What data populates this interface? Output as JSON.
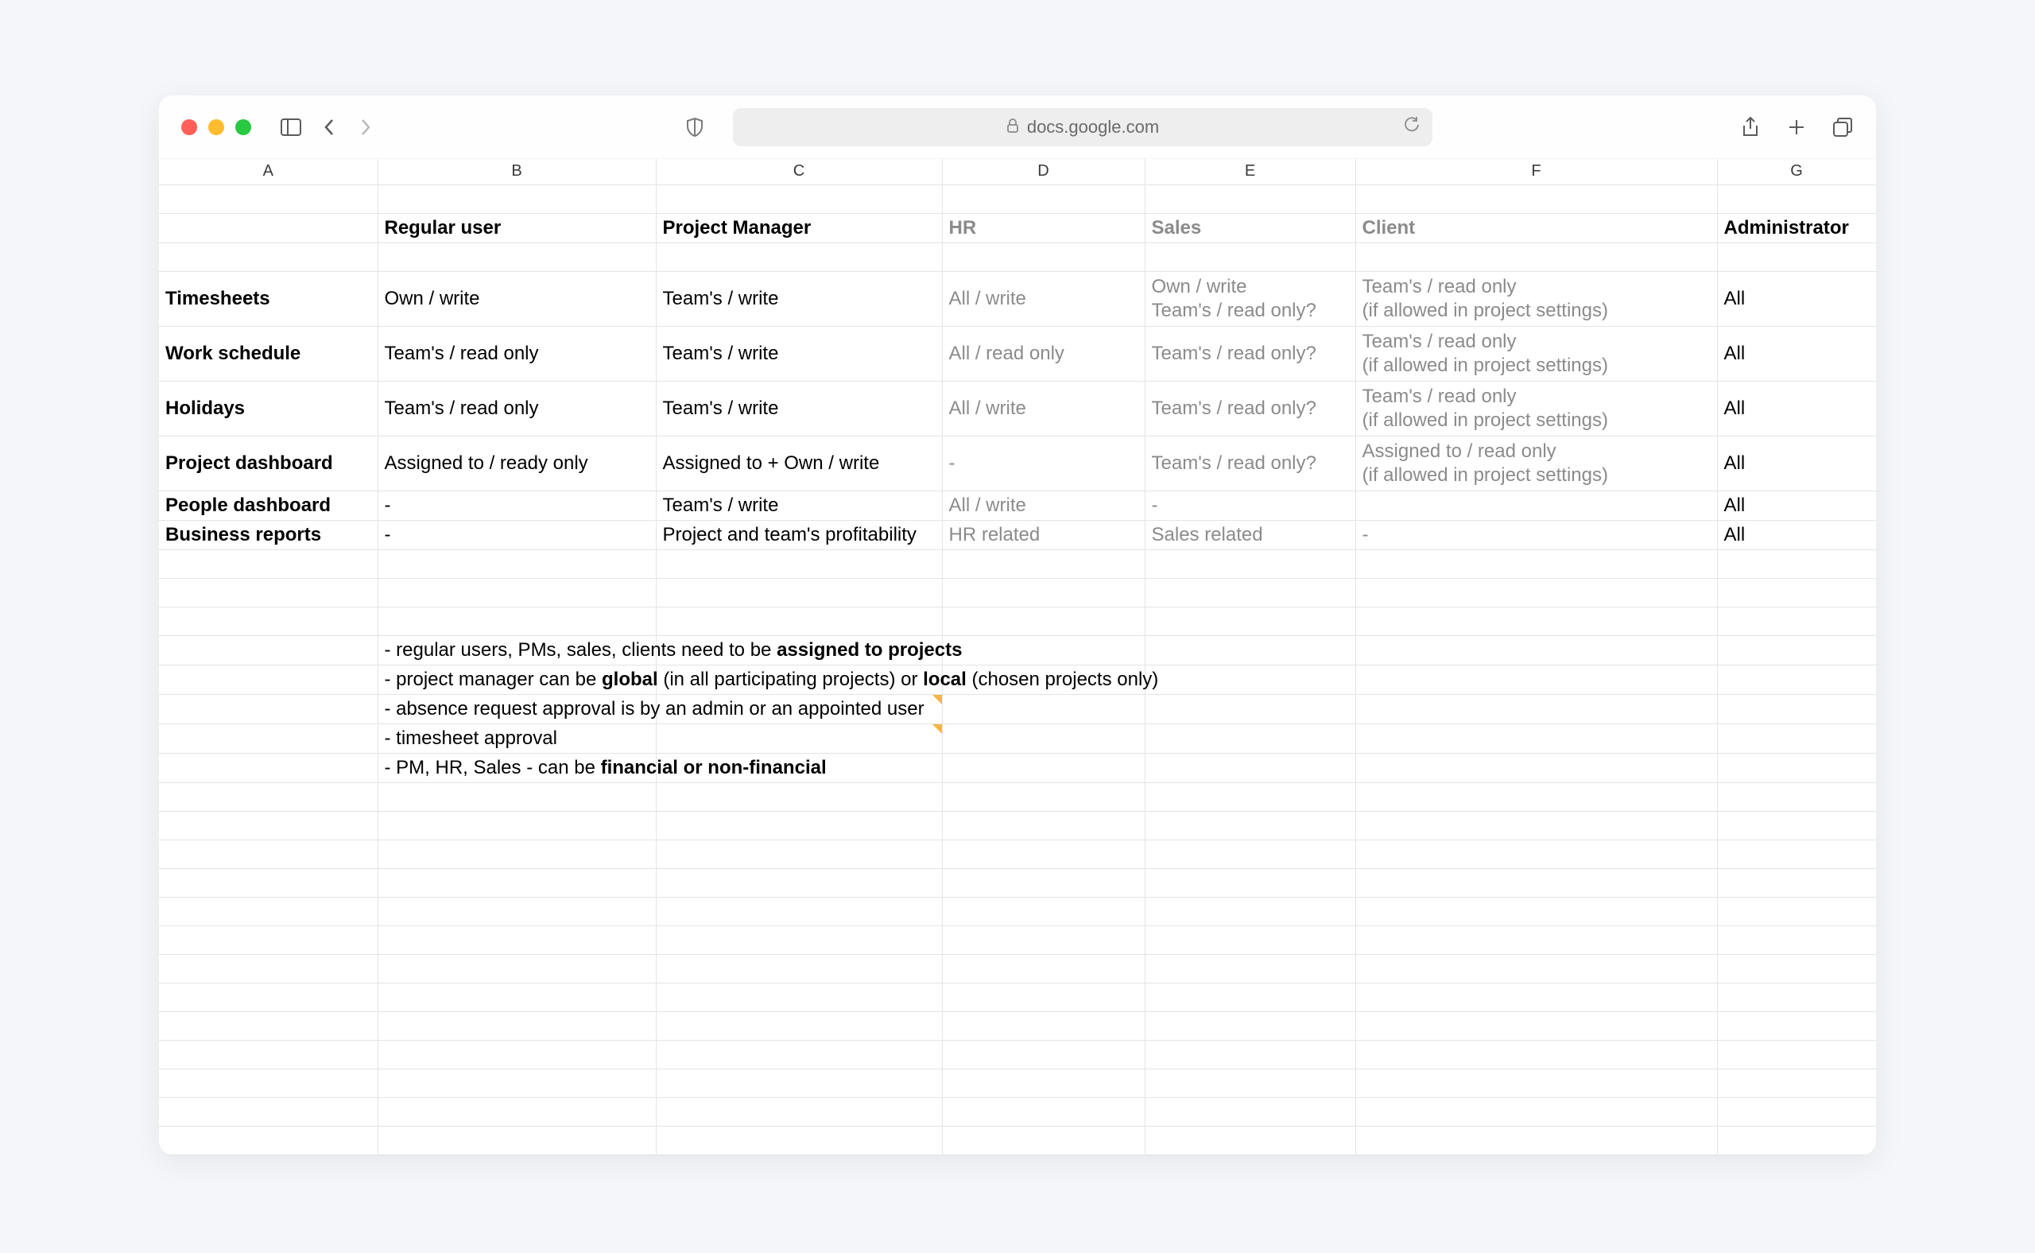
{
  "toolbar": {
    "url": "docs.google.com"
  },
  "columns": [
    "A",
    "B",
    "C",
    "D",
    "E",
    "F",
    "G"
  ],
  "headers": {
    "B": "Regular user",
    "C": "Project Manager",
    "D": "HR",
    "E": "Sales",
    "F": "Client",
    "G": "Administrator"
  },
  "rows": [
    {
      "label": "Timesheets",
      "B": "Own / write",
      "C": "Team's / write",
      "D": "All / write",
      "E": "Own / write\nTeam's / read only?",
      "F": "Team's / read only\n(if allowed in project settings)",
      "G": "All"
    },
    {
      "label": "Work schedule",
      "B": "Team's / read only",
      "C": "Team's / write",
      "D": "All / read only",
      "E": "Team's / read only?",
      "F": "Team's / read only\n(if allowed in project settings)",
      "G": "All"
    },
    {
      "label": "Holidays",
      "B": "Team's / read only",
      "C": "Team's / write",
      "D": "All / write",
      "E": "Team's / read only?",
      "F": "Team's / read only\n(if allowed in project settings)",
      "G": "All"
    },
    {
      "label": "Project dashboard",
      "B": "Assigned to / ready only",
      "C": "Assigned to + Own / write",
      "D": "-",
      "E": "Team's / read only?",
      "F": "Assigned to / read only\n(if allowed in project settings)",
      "G": "All"
    },
    {
      "label": "People dashboard",
      "B": "-",
      "C": "Team's / write",
      "D": "All / write",
      "E": "-",
      "F": "",
      "G": "All"
    },
    {
      "label": "Business reports",
      "B": "-",
      "C": "Project and team's profitability",
      "D": "HR related",
      "E": "Sales related",
      "F": "-",
      "G": "All"
    }
  ],
  "notes": [
    {
      "pre": "- regular users, PMs, sales, clients need to be ",
      "b1": "assigned to projects",
      "mid": "",
      "b2": "",
      "post": ""
    },
    {
      "pre": "- project manager can be ",
      "b1": "global",
      "mid": " (in all participating projects) or ",
      "b2": "local",
      "post": " (chosen projects only)"
    },
    {
      "pre": "- absence request approval is by an admin or an appointed user",
      "b1": "",
      "mid": "",
      "b2": "",
      "post": ""
    },
    {
      "pre": "- timesheet approval",
      "b1": "",
      "mid": "",
      "b2": "",
      "post": ""
    },
    {
      "pre": "- PM, HR, Sales - can be ",
      "b1": "financial or non-financial",
      "mid": "",
      "b2": "",
      "post": ""
    }
  ],
  "greyColumns": [
    "D",
    "E",
    "F"
  ],
  "multilineRows": [
    0,
    1,
    2,
    3
  ],
  "emptyRowsAfterData": 3,
  "emptyRowsAfterNotes": 13
}
